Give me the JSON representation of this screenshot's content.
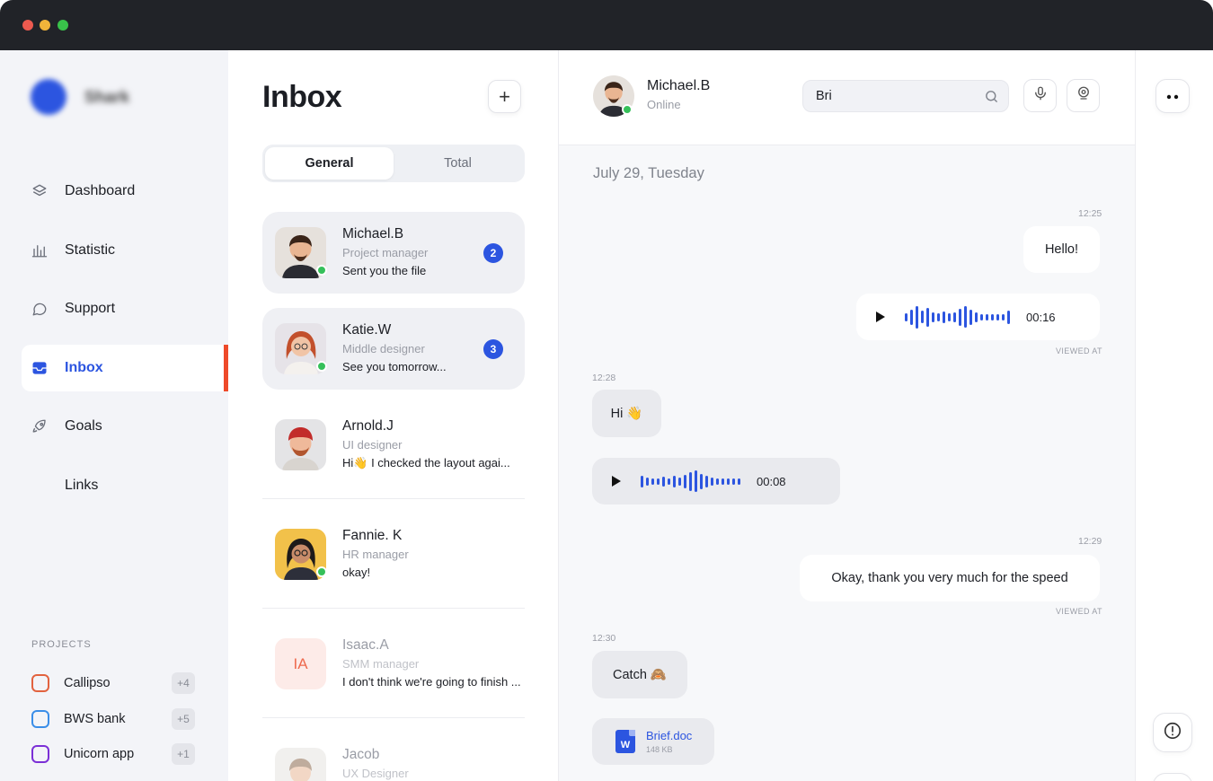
{
  "window": {
    "controls": [
      "close",
      "minimize",
      "maximize"
    ]
  },
  "colors": {
    "accent": "#2c55e0",
    "active_marker": "#ee4a2a",
    "online": "#36c05a",
    "close": "#ed5a4f",
    "minimize": "#f0b43a",
    "maximize": "#39c24a"
  },
  "brand": {
    "name": "Shark"
  },
  "nav": {
    "items": [
      {
        "label": "Dashboard",
        "icon": "layers-icon"
      },
      {
        "label": "Statistic",
        "icon": "bar-chart-icon"
      },
      {
        "label": "Support",
        "icon": "chat-bubble-icon"
      },
      {
        "label": "Inbox",
        "icon": "inbox-icon",
        "active": true
      },
      {
        "label": "Goals",
        "icon": "rocket-icon"
      },
      {
        "label": "Links",
        "icon": ""
      }
    ]
  },
  "projects": {
    "title": "PROJECTS",
    "items": [
      {
        "name": "Callipso",
        "count": "+4",
        "color": "#e2623f"
      },
      {
        "name": "BWS bank",
        "count": "+5",
        "color": "#3b8ee8"
      },
      {
        "name": "Unicorn app",
        "count": "+1",
        "color": "#7b2fd6"
      }
    ]
  },
  "inbox": {
    "title": "Inbox",
    "add_label": "+",
    "tabs": [
      {
        "label": "General",
        "active": true
      },
      {
        "label": "Total"
      }
    ],
    "conversations": [
      {
        "name": "Michael.B",
        "role": "Project manager",
        "message": "Sent you the file",
        "badge": "2",
        "online": true
      },
      {
        "name": "Katie.W",
        "role": "Middle designer",
        "message": "See you tomorrow...",
        "badge": "3",
        "online": true
      },
      {
        "name": "Arnold.J",
        "role": "UI designer",
        "message": "Hi👋 I checked the layout agai..."
      },
      {
        "name": "Fannie. K",
        "role": "HR manager",
        "message": "okay!",
        "online": true
      },
      {
        "name": "Isaac.A",
        "role": "SMM manager",
        "message": "I don't think we're going to finish ...",
        "initials": "IA"
      },
      {
        "name": "Jacob",
        "role": "UX Designer",
        "message": ""
      }
    ]
  },
  "chat": {
    "contact": {
      "name": "Michael.B",
      "status": "Online"
    },
    "search": {
      "value": "Bri",
      "placeholder": ""
    },
    "date": "July 29, Tuesday",
    "messages": [
      {
        "time": "12:25",
        "text": "Hello!"
      },
      {
        "duration": "00:16",
        "viewed": "VIEWED AT"
      },
      {
        "time": "12:28",
        "text": "Hi 👋"
      },
      {
        "duration": "00:08"
      },
      {
        "time": "12:29",
        "text": "Okay, thank you very much for the speed",
        "viewed": "VIEWED AT"
      },
      {
        "time": "12:30",
        "text": "Catch 🙈"
      },
      {
        "file_name": "Brief.doc",
        "file_size": "148 KB",
        "file_type": "W"
      }
    ]
  }
}
